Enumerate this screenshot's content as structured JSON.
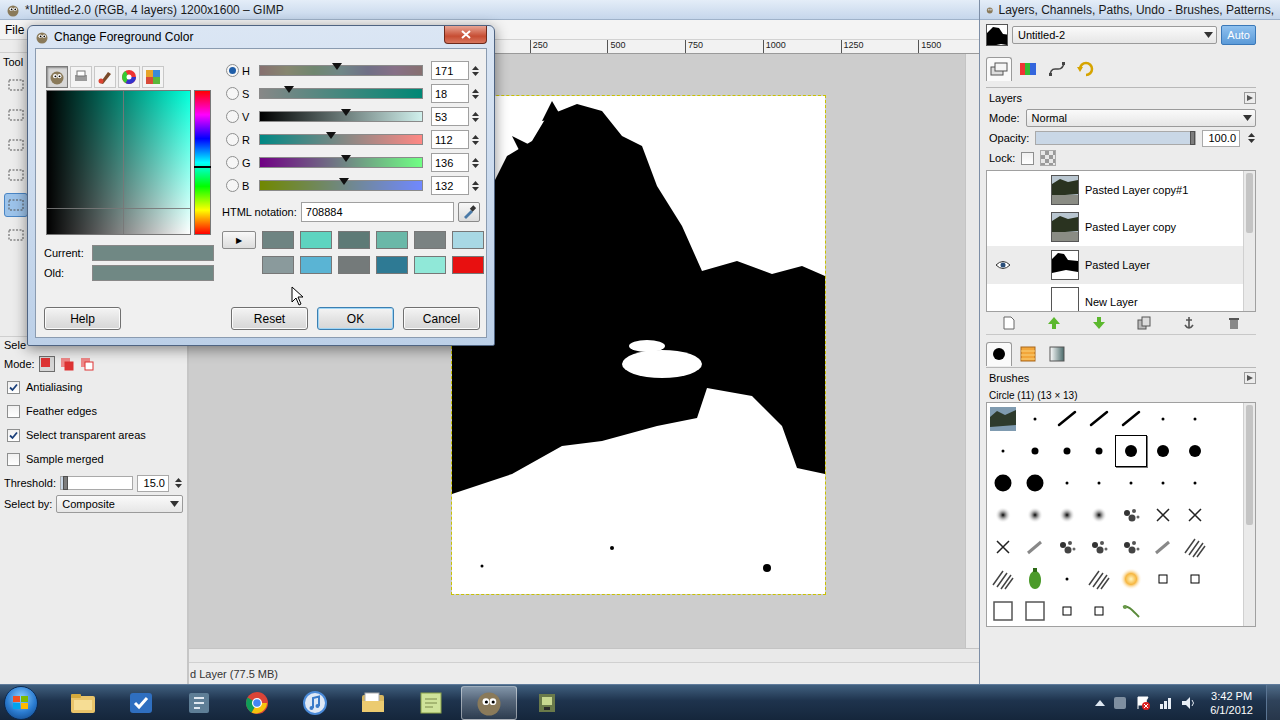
{
  "main_window": {
    "title": "*Untitled-2.0 (RGB, 4 layers) 1200x1600 – GIMP",
    "menus": [
      "File"
    ]
  },
  "toolbox": {
    "title": "Tool",
    "tools": [
      {
        "selected": false
      },
      {
        "selected": false
      },
      {
        "selected": false
      },
      {
        "selected": false
      },
      {
        "selected": false
      },
      {
        "selected": false
      },
      {
        "selected": false
      },
      {
        "selected": false
      },
      {
        "selected": false
      },
      {
        "selected": false
      },
      {
        "selected": false
      },
      {
        "selected": false
      },
      {
        "selected": false
      },
      {
        "selected": false
      },
      {
        "selected": false
      },
      {
        "selected": false
      },
      {
        "selected": false
      },
      {
        "selected": false
      },
      {
        "selected": false
      },
      {
        "selected": false
      },
      {
        "selected": false
      },
      {
        "selected": false
      },
      {
        "selected": false
      },
      {
        "selected": false
      },
      {
        "selected": true
      },
      {
        "selected": false
      },
      {
        "selected": false
      },
      {
        "selected": false
      },
      {
        "selected": false
      },
      {
        "selected": false
      },
      {
        "selected": false
      },
      {
        "selected": false
      },
      {
        "selected": false
      },
      {
        "selected": false
      },
      {
        "selected": false
      },
      {
        "selected": false
      }
    ]
  },
  "tool_options": {
    "title": "Sele",
    "mode_label": "Mode:",
    "modes": [
      {
        "selected": true
      },
      {
        "selected": false
      },
      {
        "selected": false
      }
    ],
    "options": [
      {
        "label": "Antialiasing",
        "checked": true
      },
      {
        "label": "Feather edges",
        "checked": false
      },
      {
        "label": "Select transparent areas",
        "checked": true
      },
      {
        "label": "Sample merged",
        "checked": false
      }
    ],
    "threshold": {
      "label": "Threshold:",
      "value": "15.0",
      "level": 0.06
    },
    "select_by": {
      "label": "Select by:",
      "value": "Composite"
    }
  },
  "canvas": {
    "ruler": [
      "250",
      "500",
      "750",
      "1000",
      "1250",
      "1500"
    ],
    "status": "d Layer (77.5 MB)"
  },
  "dock": {
    "title": "Layers, Channels, Paths, Undo - Brushes, Patterns,",
    "image": "Untitled-2",
    "auto": {
      "label": "Auto",
      "on": true
    },
    "tabs": [
      {
        "kind": "layers",
        "selected": true
      },
      {
        "kind": "channels",
        "selected": false
      },
      {
        "kind": "paths",
        "selected": false
      },
      {
        "kind": "undo",
        "selected": false
      }
    ],
    "layers_panel": {
      "title": "Layers",
      "mode_label": "Mode:",
      "mode": "Normal",
      "opacity_label": "Opacity:",
      "opacity": "100.0",
      "opacity_level": 1.0,
      "lock_label": "Lock:",
      "lock_pixels": false,
      "lock_alpha": false,
      "layers": [
        {
          "name": "Pasted Layer copy#1",
          "visible": false,
          "selected": false,
          "thumb": "photo"
        },
        {
          "name": "Pasted Layer copy",
          "visible": false,
          "selected": false,
          "thumb": "photo"
        },
        {
          "name": "Pasted Layer",
          "visible": true,
          "selected": true,
          "thumb": "silhouette"
        },
        {
          "name": "New Layer",
          "visible": false,
          "selected": false,
          "thumb": "blank"
        }
      ]
    },
    "brush_tabs": [
      {
        "kind": "brushes",
        "selected": true
      },
      {
        "kind": "patterns",
        "selected": false
      },
      {
        "kind": "gradients",
        "selected": false
      }
    ],
    "brushes_panel": {
      "title": "Brushes",
      "current": "Circle (11) (13 × 13)",
      "brushes": [
        {
          "kind": "photo",
          "selected": false
        },
        {
          "kind": "speck",
          "selected": false
        },
        {
          "kind": "stroke",
          "selected": false
        },
        {
          "kind": "stroke",
          "selected": false
        },
        {
          "kind": "stroke",
          "selected": false
        },
        {
          "kind": "speck",
          "selected": false
        },
        {
          "kind": "speck",
          "selected": false
        },
        {
          "kind": "speck",
          "selected": false
        },
        {
          "kind": "dot",
          "selected": false
        },
        {
          "kind": "dot",
          "selected": false
        },
        {
          "kind": "dot",
          "selected": false
        },
        {
          "kind": "bigdot",
          "selected": true
        },
        {
          "kind": "bigdot",
          "selected": false
        },
        {
          "kind": "bigdot",
          "selected": false
        },
        {
          "kind": "hugedot",
          "selected": false
        },
        {
          "kind": "hugedot",
          "selected": false
        },
        {
          "kind": "speck",
          "selected": false
        },
        {
          "kind": "speck",
          "selected": false
        },
        {
          "kind": "speck",
          "selected": false
        },
        {
          "kind": "speck",
          "selected": false
        },
        {
          "kind": "speck",
          "selected": false
        },
        {
          "kind": "fuzzy",
          "selected": false
        },
        {
          "kind": "fuzzy",
          "selected": false
        },
        {
          "kind": "fuzzy",
          "selected": false
        },
        {
          "kind": "fuzzy",
          "selected": false
        },
        {
          "kind": "splatter",
          "selected": false
        },
        {
          "kind": "cross",
          "selected": false
        },
        {
          "kind": "cross",
          "selected": false
        },
        {
          "kind": "cross",
          "selected": false
        },
        {
          "kind": "pencil",
          "selected": false
        },
        {
          "kind": "splatter",
          "selected": false
        },
        {
          "kind": "splatter",
          "selected": false
        },
        {
          "kind": "splatter",
          "selected": false
        },
        {
          "kind": "pencil",
          "selected": false
        },
        {
          "kind": "hatch",
          "selected": false
        },
        {
          "kind": "hatch",
          "selected": false
        },
        {
          "kind": "pepper",
          "selected": false
        },
        {
          "kind": "speck",
          "selected": false
        },
        {
          "kind": "hatch",
          "selected": false
        },
        {
          "kind": "glow",
          "selected": false
        },
        {
          "kind": "square",
          "selected": false
        },
        {
          "kind": "square",
          "selected": false
        },
        {
          "kind": "frame",
          "selected": false
        },
        {
          "kind": "frame",
          "selected": false
        },
        {
          "kind": "square",
          "selected": false
        },
        {
          "kind": "square",
          "selected": false
        },
        {
          "kind": "leaf",
          "selected": false
        }
      ]
    }
  },
  "dialog": {
    "title": "Change Foreground Color",
    "tabs": [
      {
        "kind": "gimp",
        "selected": true
      },
      {
        "kind": "cmyk",
        "selected": false
      },
      {
        "kind": "watercolor",
        "selected": false
      },
      {
        "kind": "wheel",
        "selected": false
      },
      {
        "kind": "scales",
        "selected": false
      }
    ],
    "channels": [
      {
        "label": "H",
        "value": "171",
        "level": 0.475,
        "selected": true,
        "kind": "hue"
      },
      {
        "label": "S",
        "value": "18",
        "level": 0.18,
        "selected": false,
        "kind": "saturation"
      },
      {
        "label": "V",
        "value": "53",
        "level": 0.53,
        "selected": false,
        "kind": "value"
      },
      {
        "label": "R",
        "value": "112",
        "level": 0.439,
        "selected": false,
        "kind": "red"
      },
      {
        "label": "G",
        "value": "136",
        "level": 0.533,
        "selected": false,
        "kind": "green"
      },
      {
        "label": "B",
        "value": "132",
        "level": 0.518,
        "selected": false,
        "kind": "blue"
      }
    ],
    "html": {
      "label": "HTML notation:",
      "value": "708884"
    },
    "current": {
      "label": "Current:",
      "color": "#708884"
    },
    "old": {
      "label": "Old:",
      "color": "#708884"
    },
    "history": {
      "arrow": "▶",
      "swatches": [
        {
          "color": "#6e8482"
        },
        {
          "color": "#5ed4c0"
        },
        {
          "color": "#5e7a76"
        },
        {
          "color": "#6ab8a8"
        },
        {
          "color": "#7a8282"
        },
        {
          "color": "#a8d8e4"
        },
        {
          "color": "#8a9a9c"
        },
        {
          "color": "#5ab4d4"
        },
        {
          "color": "#747a7a"
        },
        {
          "color": "#2e7a94"
        },
        {
          "color": "#90e8d8"
        },
        {
          "color": "#e81010"
        }
      ]
    },
    "buttons": [
      {
        "label": "Help",
        "default": false
      },
      {
        "label": "Reset",
        "default": false
      },
      {
        "label": "OK",
        "default": true
      },
      {
        "label": "Cancel",
        "default": false
      }
    ]
  },
  "taskbar": {
    "apps": [
      {
        "kind": "explorer",
        "active": false
      },
      {
        "kind": "tasks",
        "active": false
      },
      {
        "kind": "tool",
        "active": false
      },
      {
        "kind": "chrome",
        "active": false
      },
      {
        "kind": "itunes",
        "active": false
      },
      {
        "kind": "folder",
        "active": false
      },
      {
        "kind": "notes",
        "active": false
      },
      {
        "kind": "gimp",
        "active": true
      },
      {
        "kind": "app",
        "active": false
      }
    ],
    "time": "3:42 PM",
    "date": "6/1/2012"
  }
}
